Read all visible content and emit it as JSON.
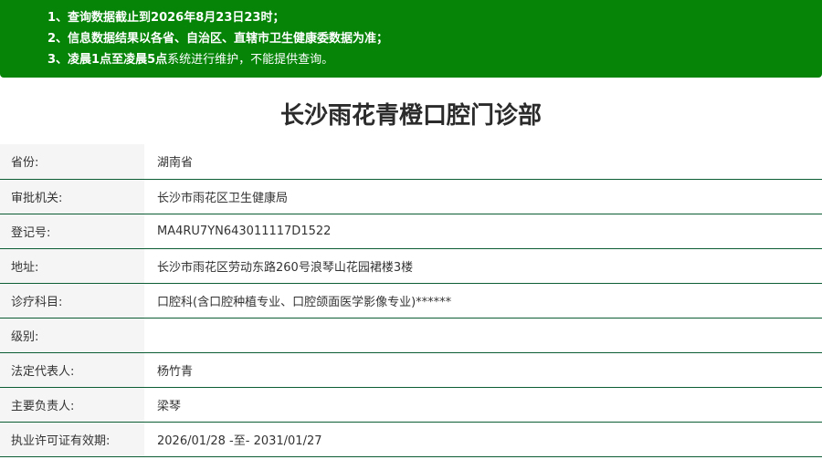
{
  "notice": {
    "line1": {
      "prefix": "1、查询数据截止到",
      "date": "2026年8月23日23时",
      "suffix": "；"
    },
    "line2": {
      "text": "2、信息数据结果以各省、自治区、直辖市卫生健康委数据为准；"
    },
    "line3": {
      "prefix": "3、",
      "hours": "凌晨1点至凌晨5点",
      "suffix": "系统进行维护，不能提供查询。"
    }
  },
  "title": "长沙雨花青橙口腔门诊部",
  "rows": [
    {
      "label": "省份:",
      "value": "湖南省"
    },
    {
      "label": "审批机关:",
      "value": "长沙市雨花区卫生健康局"
    },
    {
      "label": "登记号:",
      "value": "MA4RU7YN643011117D1522"
    },
    {
      "label": "地址:",
      "value": "长沙市雨花区劳动东路260号浪琴山花园裙楼3楼"
    },
    {
      "label": "诊疗科目:",
      "value": "口腔科(含口腔种植专业、口腔颌面医学影像专业)******"
    },
    {
      "label": "级别:",
      "value": ""
    },
    {
      "label": "法定代表人:",
      "value": "杨竹青"
    },
    {
      "label": "主要负责人:",
      "value": "梁琴"
    },
    {
      "label": "执业许可证有效期:",
      "value": "2026/01/28 -至- 2031/01/27"
    }
  ],
  "colors": {
    "notice_bg": "#058408",
    "row_border": "#0c5c34",
    "label_bg": "#f5f5f5"
  }
}
